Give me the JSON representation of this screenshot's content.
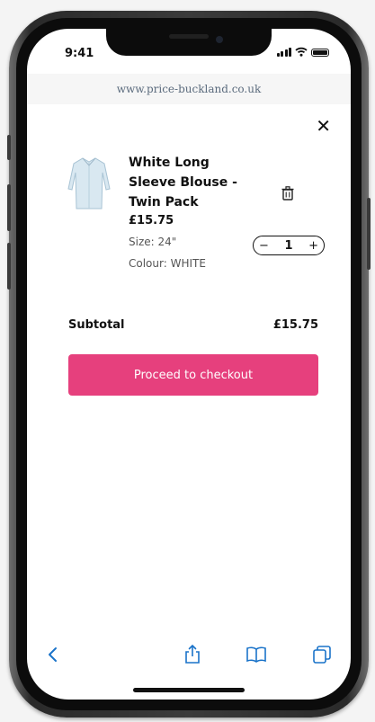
{
  "status": {
    "time": "9:41"
  },
  "browser": {
    "url": "www.price-buckland.co.uk"
  },
  "cart": {
    "product": {
      "name": "White Long Sleeve Blouse - Twin Pack",
      "price": "£15.75",
      "size": "Size: 24\"",
      "colour": "Colour: WHITE",
      "quantity": "1"
    },
    "subtotal_label": "Subtotal",
    "subtotal_value": "£15.75",
    "checkout_label": "Proceed to checkout",
    "close_symbol": "✕",
    "minus_symbol": "−",
    "plus_symbol": "+"
  },
  "icons": {
    "close": "close-icon",
    "trash": "trash-icon",
    "back": "chevron-left-icon",
    "share": "share-icon",
    "bookmarks": "book-icon",
    "tabs": "tabs-icon"
  },
  "colors": {
    "accent": "#e6407d",
    "toolbar_icon": "#1a73c9"
  }
}
